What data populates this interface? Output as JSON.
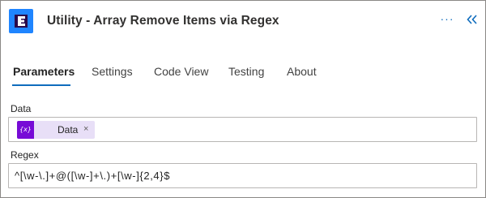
{
  "header": {
    "title": "Utility - Array Remove Items via Regex",
    "icon": "utility-connector-icon",
    "more_label": "···",
    "collapse_icon": "chevron-double-left-icon",
    "accent_color": "#1f85ff"
  },
  "tabs": [
    {
      "label": "Parameters",
      "active": true
    },
    {
      "label": "Settings",
      "active": false
    },
    {
      "label": "Code View",
      "active": false
    },
    {
      "label": "Testing",
      "active": false
    },
    {
      "label": "About",
      "active": false
    }
  ],
  "fields": {
    "data": {
      "label": "Data",
      "token": {
        "label": "Data",
        "icon_text": "{x}",
        "icon": "variable-icon",
        "color": "#770bd6",
        "remove": "×"
      }
    },
    "regex": {
      "label": "Regex",
      "value": "^[\\w-\\.]+@([\\w-]+\\.)+[\\w-]{2,4}$"
    }
  }
}
